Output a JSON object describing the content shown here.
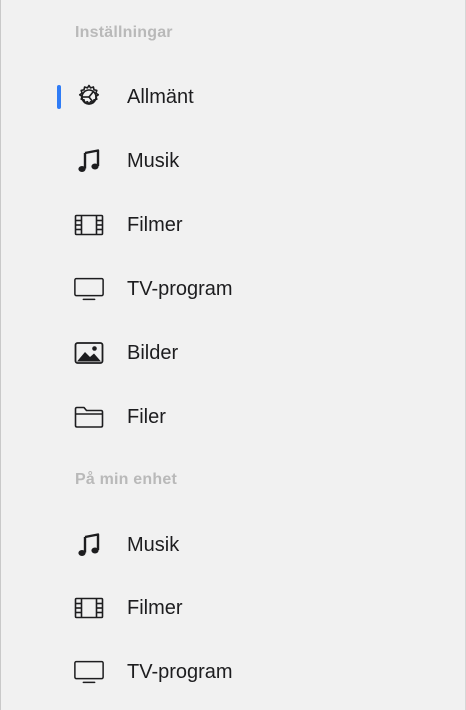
{
  "colors": {
    "background": "#f1f1f1",
    "header_text": "#b9b9b9",
    "item_text": "#1d1d1f",
    "selection_accent": "#2f7cf6"
  },
  "sections": [
    {
      "header": "Inställningar",
      "items": [
        {
          "label": "Allmänt",
          "icon": "gear-icon",
          "selected": true
        },
        {
          "label": "Musik",
          "icon": "music-note-icon",
          "selected": false
        },
        {
          "label": "Filmer",
          "icon": "film-icon",
          "selected": false
        },
        {
          "label": "TV-program",
          "icon": "tv-icon",
          "selected": false
        },
        {
          "label": "Bilder",
          "icon": "photo-icon",
          "selected": false
        },
        {
          "label": "Filer",
          "icon": "folder-icon",
          "selected": false
        }
      ]
    },
    {
      "header": "På min enhet",
      "items": [
        {
          "label": "Musik",
          "icon": "music-note-icon",
          "selected": false
        },
        {
          "label": "Filmer",
          "icon": "film-icon",
          "selected": false
        },
        {
          "label": "TV-program",
          "icon": "tv-icon",
          "selected": false
        }
      ]
    }
  ]
}
